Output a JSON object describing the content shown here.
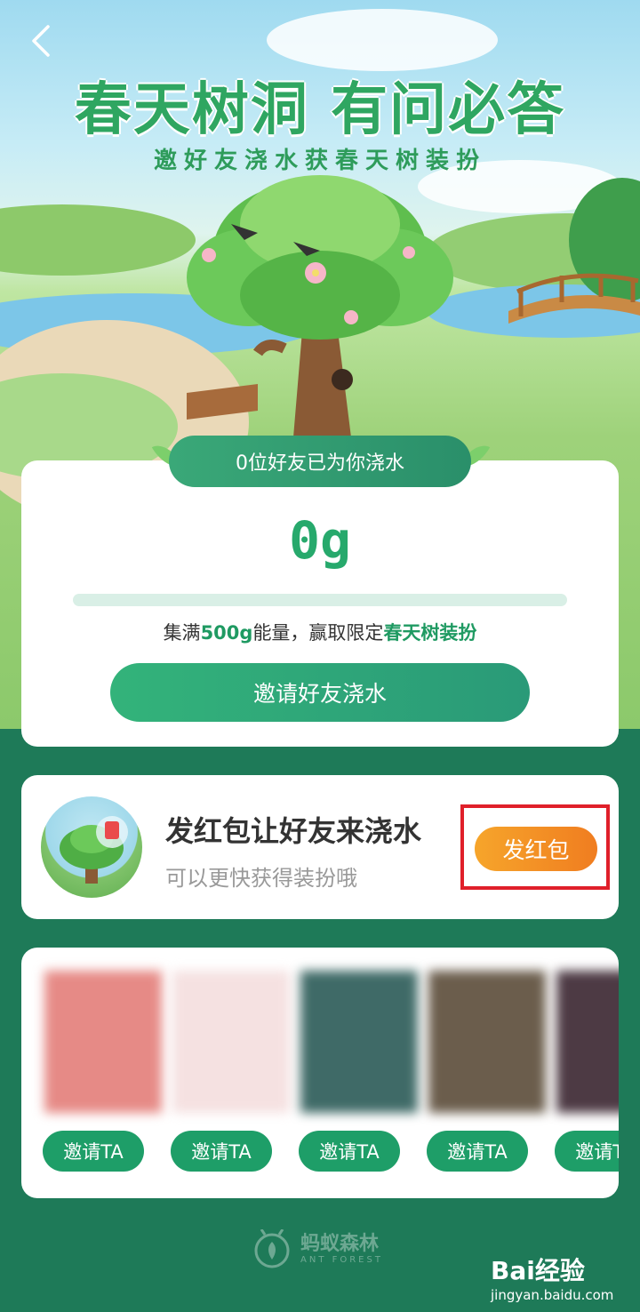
{
  "hero": {
    "title": "春天树洞 有问必答",
    "subtitle": "邀好友浇水获春天树装扮",
    "back_icon": "chevron-left-icon"
  },
  "watering": {
    "friends_badge": "0位好友已为你浇水",
    "energy_value": "0g",
    "progress": 0,
    "hint_prefix": "集满",
    "hint_amount": "500g",
    "hint_middle": "能量，赢取限定",
    "hint_reward": "春天树装扮",
    "invite_button": "邀请好友浇水"
  },
  "red_packet": {
    "title": "发红包让好友来浇水",
    "subtitle": "可以更快获得装扮哦",
    "button": "发红包"
  },
  "friends": {
    "invite_labels": [
      "邀请TA",
      "邀请TA",
      "邀请TA",
      "邀请TA",
      "邀请TA"
    ]
  },
  "footer": {
    "brand_cn": "蚂蚁森林",
    "brand_en": "ANT FOREST"
  },
  "watermark": {
    "main": "Bai经验",
    "sub": "jingyan.baidu.com"
  },
  "colors": {
    "primary_green": "#27a96c",
    "dark_green_bg": "#1e7a58",
    "orange_button": "#f07d20",
    "highlight_red": "#e0202a"
  }
}
